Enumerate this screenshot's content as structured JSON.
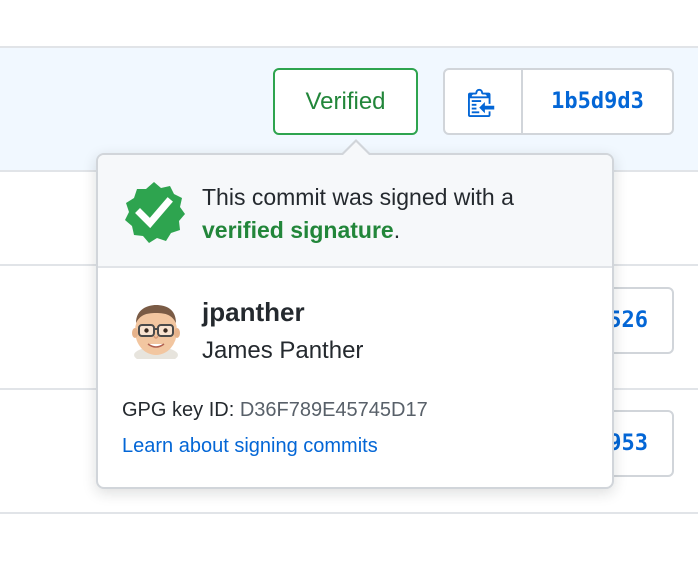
{
  "commit": {
    "verified_label": "Verified",
    "sha": "1b5d9d3"
  },
  "other_rows": {
    "sha_partial_1": "526",
    "sha_partial_2": "953"
  },
  "popover": {
    "message_prefix": "This commit was signed with a",
    "signature_link": "verified signature",
    "message_suffix": ".",
    "username": "jpanther",
    "full_name": "James Panther",
    "gpg_label": "GPG key ID:",
    "gpg_key_id": "D36F789E45745D17",
    "learn_link": "Learn about signing commits"
  },
  "colors": {
    "verified_green": "#2ea44f",
    "link_blue": "#0366d6",
    "highlight_row": "#f1f8ff",
    "header_bg": "#f6f8fa"
  },
  "icons": {
    "copy": "clippy-icon",
    "badge": "verified-badge-icon",
    "avatar": "memoji-avatar"
  }
}
